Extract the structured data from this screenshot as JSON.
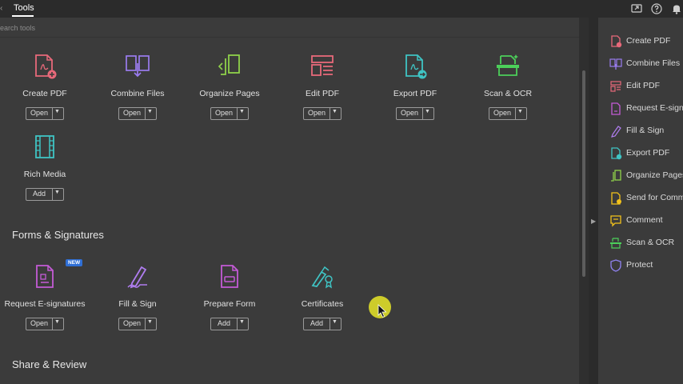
{
  "topbar": {
    "tab_label": "Tools"
  },
  "search": {
    "placeholder": "earch tools"
  },
  "sections": {
    "forms": "Forms & Signatures",
    "share": "Share & Review"
  },
  "tools_row1": [
    {
      "label": "Create PDF",
      "button": "Open"
    },
    {
      "label": "Combine Files",
      "button": "Open"
    },
    {
      "label": "Organize Pages",
      "button": "Open"
    },
    {
      "label": "Edit PDF",
      "button": "Open"
    },
    {
      "label": "Export PDF",
      "button": "Open"
    },
    {
      "label": "Scan & OCR",
      "button": "Open"
    }
  ],
  "tools_row2": [
    {
      "label": "Rich Media",
      "button": "Add"
    }
  ],
  "tools_forms": [
    {
      "label": "Request E-signatures",
      "button": "Open",
      "badge": "NEW"
    },
    {
      "label": "Fill & Sign",
      "button": "Open"
    },
    {
      "label": "Prepare Form",
      "button": "Add"
    },
    {
      "label": "Certificates",
      "button": "Add"
    }
  ],
  "right_panel": [
    {
      "label": "Create PDF",
      "icon": "create-pdf-icon",
      "color": "#e8697a"
    },
    {
      "label": "Combine Files",
      "icon": "combine-files-icon",
      "color": "#9a7cf0"
    },
    {
      "label": "Edit PDF",
      "icon": "edit-pdf-icon",
      "color": "#e8697a"
    },
    {
      "label": "Request E-signatures",
      "icon": "request-esign-icon",
      "color": "#c45bd6"
    },
    {
      "label": "Fill & Sign",
      "icon": "fill-sign-icon",
      "color": "#b07df0"
    },
    {
      "label": "Export PDF",
      "icon": "export-pdf-icon",
      "color": "#3fc4c4"
    },
    {
      "label": "Organize Pages",
      "icon": "organize-pages-icon",
      "color": "#8fd24a"
    },
    {
      "label": "Send for Comments",
      "icon": "send-comments-icon",
      "color": "#f2c21b"
    },
    {
      "label": "Comment",
      "icon": "comment-icon",
      "color": "#f2c21b"
    },
    {
      "label": "Scan & OCR",
      "icon": "scan-ocr-icon",
      "color": "#4ccf5a"
    },
    {
      "label": "Protect",
      "icon": "protect-icon",
      "color": "#8f82f0"
    }
  ]
}
